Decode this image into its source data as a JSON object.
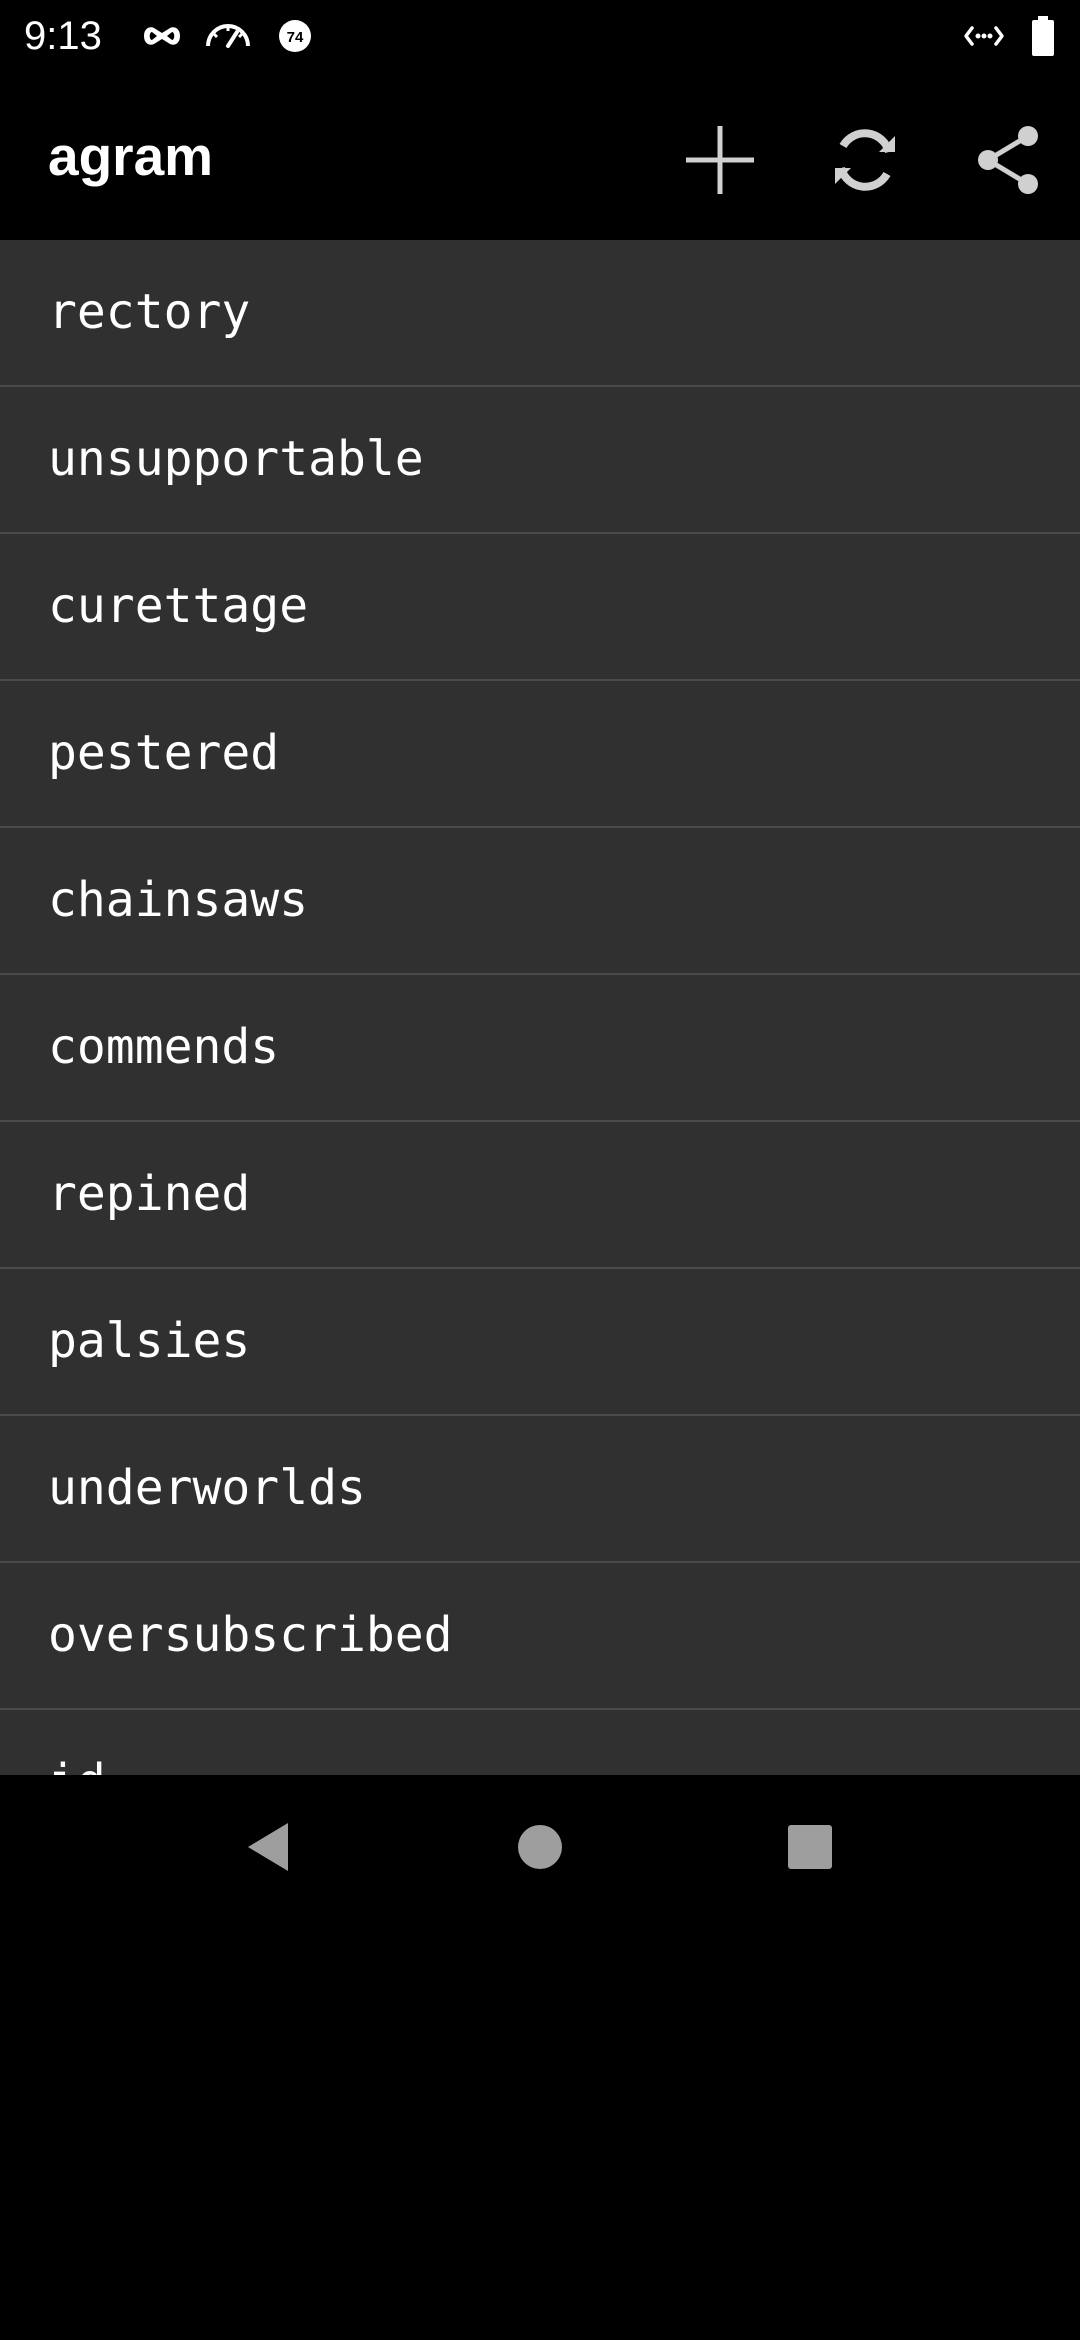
{
  "status_bar": {
    "time": "9:13",
    "icons": [
      "incognito-icon",
      "speedometer-icon",
      "badge-74-icon",
      "data-saver-icon",
      "battery-icon"
    ],
    "badge_number": "74"
  },
  "app_bar": {
    "title": "agram",
    "actions": [
      "add-icon",
      "refresh-icon",
      "share-icon"
    ]
  },
  "words": [
    "rectory",
    "unsupportable",
    "curettage",
    "pestered",
    "chainsaws",
    "commends",
    "repined",
    "palsies",
    "underworlds",
    "oversubscribed",
    "id"
  ],
  "navigation": {
    "buttons": [
      "back-icon",
      "home-icon",
      "recents-icon"
    ]
  },
  "colors": {
    "background": "#000000",
    "list_background": "#303030",
    "divider": "#4a4a4a",
    "text": "#ffffff",
    "icon": "#d0d0d0",
    "nav_icon": "#9e9e9e"
  }
}
